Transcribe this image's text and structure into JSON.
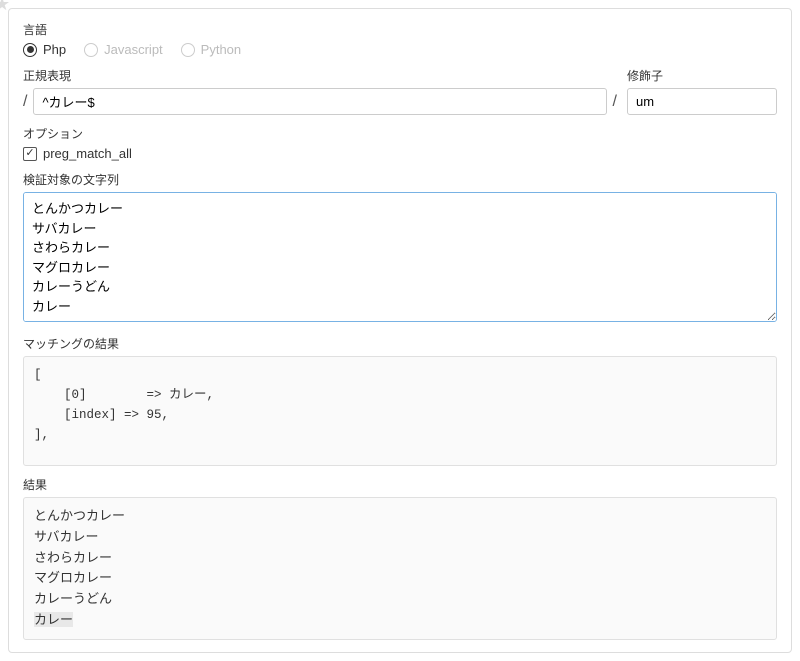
{
  "language": {
    "label": "言語",
    "options": {
      "php": "Php",
      "javascript": "Javascript",
      "python": "Python"
    }
  },
  "regex": {
    "label": "正規表現",
    "value": "^カレー$",
    "modifier_label": "修飾子",
    "modifier_value": "um"
  },
  "options": {
    "label": "オプション",
    "preg_match_all": "preg_match_all"
  },
  "test_string": {
    "label": "検証対象の文字列",
    "value": "とんかつカレー\nサバカレー\nさわらカレー\nマグロカレー\nカレーうどん\nカレー"
  },
  "match_result": {
    "label": "マッチングの結果",
    "content": "[\n    [0]        => カレー,\n    [index] => 95,\n],"
  },
  "result": {
    "label": "結果",
    "lines": [
      {
        "text": "とんかつカレー",
        "highlight": false
      },
      {
        "text": "サバカレー",
        "highlight": false
      },
      {
        "text": "さわらカレー",
        "highlight": false
      },
      {
        "text": "マグロカレー",
        "highlight": false
      },
      {
        "text": "カレーうどん",
        "highlight": false
      },
      {
        "text": "カレー",
        "highlight": true
      }
    ]
  }
}
